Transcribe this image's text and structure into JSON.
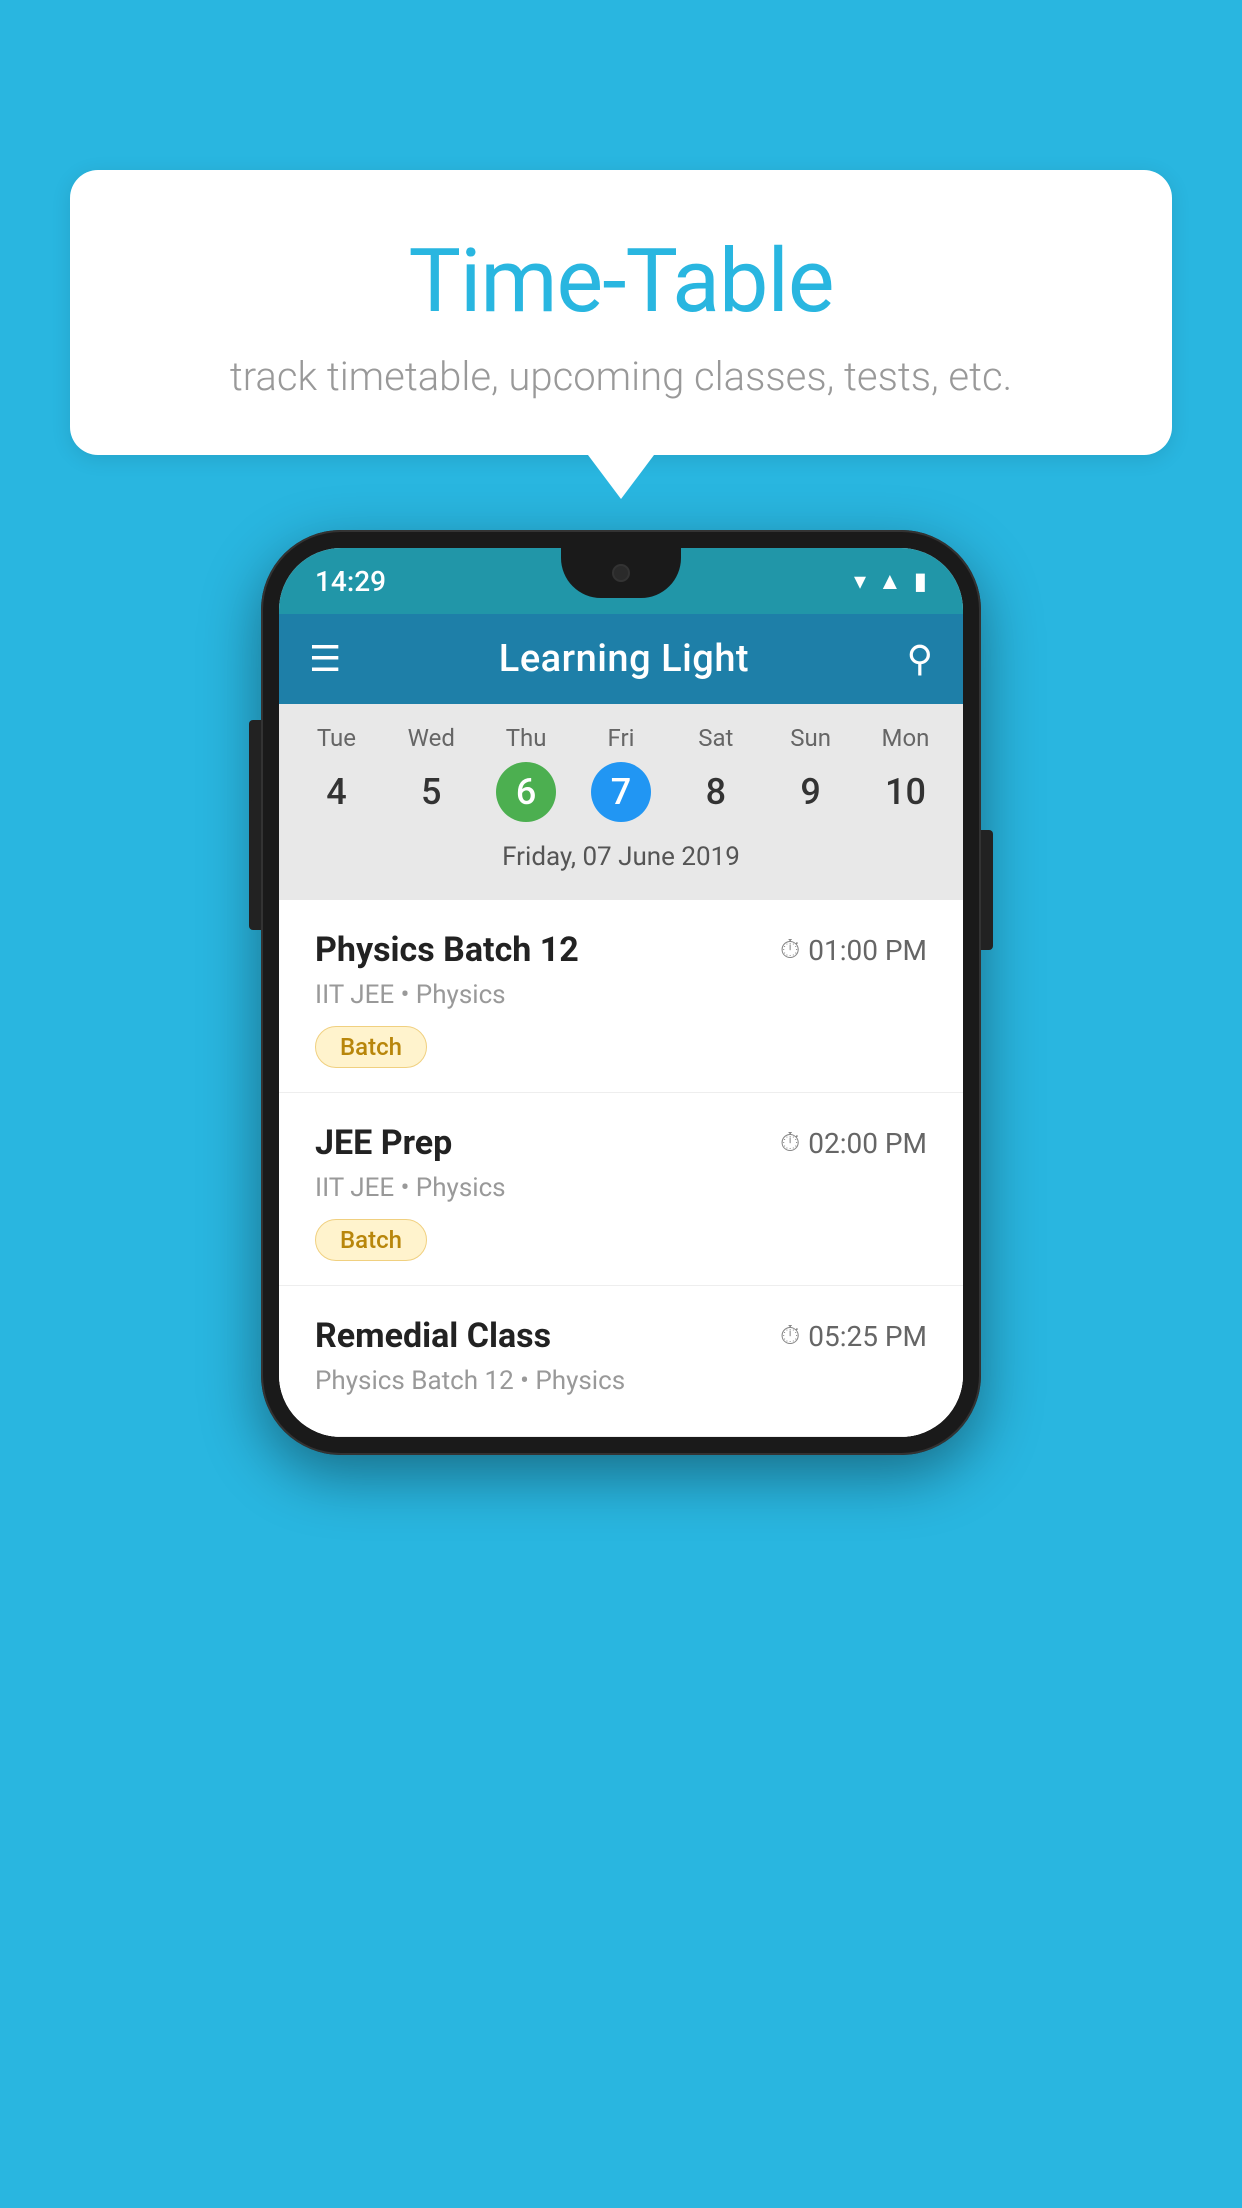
{
  "background_color": "#29b6e0",
  "bubble": {
    "title": "Time-Table",
    "subtitle": "track timetable, upcoming classes, tests, etc."
  },
  "phone": {
    "status_bar": {
      "time": "14:29"
    },
    "header": {
      "title": "Learning Light",
      "menu_icon": "☰",
      "search_icon": "🔍"
    },
    "calendar": {
      "days": [
        {
          "name": "Tue",
          "number": "4",
          "state": "normal"
        },
        {
          "name": "Wed",
          "number": "5",
          "state": "normal"
        },
        {
          "name": "Thu",
          "number": "6",
          "state": "today"
        },
        {
          "name": "Fri",
          "number": "7",
          "state": "selected"
        },
        {
          "name": "Sat",
          "number": "8",
          "state": "normal"
        },
        {
          "name": "Sun",
          "number": "9",
          "state": "normal"
        },
        {
          "name": "Mon",
          "number": "10",
          "state": "normal"
        }
      ],
      "selected_date_label": "Friday, 07 June 2019"
    },
    "events": [
      {
        "title": "Physics Batch 12",
        "time": "01:00 PM",
        "subtitle": "IIT JEE • Physics",
        "badge": "Batch"
      },
      {
        "title": "JEE Prep",
        "time": "02:00 PM",
        "subtitle": "IIT JEE • Physics",
        "badge": "Batch"
      },
      {
        "title": "Remedial Class",
        "time": "05:25 PM",
        "subtitle": "Physics Batch 12 • Physics",
        "badge": null
      }
    ]
  }
}
